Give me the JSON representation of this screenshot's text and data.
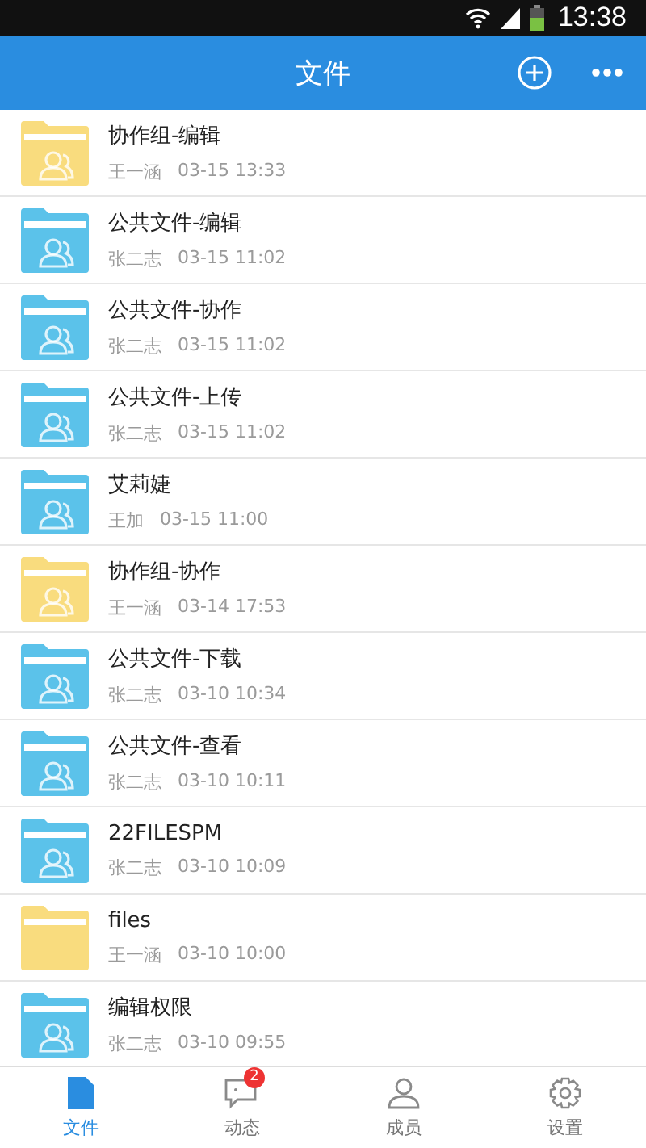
{
  "status_bar": {
    "time": "13:38"
  },
  "header": {
    "title": "文件"
  },
  "files": [
    {
      "name": "协作组-编辑",
      "owner": "王一涵",
      "time": "03-15 13:33",
      "color": "#f9dc7e",
      "shared": true
    },
    {
      "name": "公共文件-编辑",
      "owner": "张二志",
      "time": "03-15 11:02",
      "color": "#5bc2ea",
      "shared": true
    },
    {
      "name": "公共文件-协作",
      "owner": "张二志",
      "time": "03-15 11:02",
      "color": "#5bc2ea",
      "shared": true
    },
    {
      "name": "公共文件-上传",
      "owner": "张二志",
      "time": "03-15 11:02",
      "color": "#5bc2ea",
      "shared": true
    },
    {
      "name": "艾莉婕",
      "owner": "王加",
      "time": "03-15 11:00",
      "color": "#5bc2ea",
      "shared": true
    },
    {
      "name": "协作组-协作",
      "owner": "王一涵",
      "time": "03-14 17:53",
      "color": "#f9dc7e",
      "shared": true
    },
    {
      "name": "公共文件-下载",
      "owner": "张二志",
      "time": "03-10 10:34",
      "color": "#5bc2ea",
      "shared": true
    },
    {
      "name": "公共文件-查看",
      "owner": "张二志",
      "time": "03-10 10:11",
      "color": "#5bc2ea",
      "shared": true
    },
    {
      "name": "22FILESPM",
      "owner": "张二志",
      "time": "03-10 10:09",
      "color": "#5bc2ea",
      "shared": true
    },
    {
      "name": "files",
      "owner": "王一涵",
      "time": "03-10 10:00",
      "color": "#f9dc7e",
      "shared": false
    },
    {
      "name": "编辑权限",
      "owner": "张二志",
      "time": "03-10 09:55",
      "color": "#5bc2ea",
      "shared": true
    }
  ],
  "tabs": [
    {
      "label": "文件",
      "kind": "file",
      "selected": true
    },
    {
      "label": "动态",
      "kind": "activity",
      "selected": false,
      "badge": "2"
    },
    {
      "label": "成员",
      "kind": "members",
      "selected": false
    },
    {
      "label": "设置",
      "kind": "settings",
      "selected": false
    }
  ]
}
